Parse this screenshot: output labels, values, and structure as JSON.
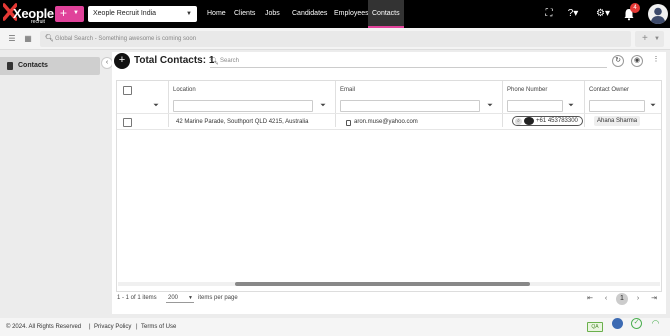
{
  "header": {
    "logo_text": "Xeople",
    "logo_sub": "recruit",
    "add_label": "+",
    "company": "Xeople Recruit India",
    "nav": [
      "Home",
      "Clients",
      "Jobs",
      "Candidates",
      "Employees",
      "Contacts"
    ],
    "active_nav": "Contacts",
    "notification_count": "4",
    "icons": [
      "fullscreen-icon",
      "help-icon",
      "settings-icon",
      "bell-icon",
      "user-avatar"
    ]
  },
  "subbar": {
    "search_placeholder": "Global Search - Something awesome is coming soon",
    "add_label": "+"
  },
  "sidebar": {
    "items": [
      {
        "label": "Contacts",
        "icon": "document-icon"
      }
    ]
  },
  "main": {
    "title": "Total Contacts: 1",
    "search_placeholder": "Search",
    "columns": [
      "Location",
      "Email",
      "Phone Number",
      "Contact Owner"
    ],
    "rows": [
      {
        "location": "42 Marine Parade, Southport QLD 4215, Australia",
        "email": "aron.muse@yahoo.com",
        "phone": "+61 453783300",
        "owner": "Ahana Sharma"
      }
    ],
    "pager": {
      "count_text": "1 - 1 of 1 items",
      "page_size": "200",
      "per_page_label": "items per page",
      "current_page": "1"
    }
  },
  "footer": {
    "copyright": "© 2024. All Rights Reserved",
    "privacy": "Privacy Policy",
    "terms": "Terms of Use",
    "qa_label": "QA"
  },
  "colors": {
    "accent": "#e0429a",
    "topbar": "#000000",
    "badge": "#e53935"
  }
}
